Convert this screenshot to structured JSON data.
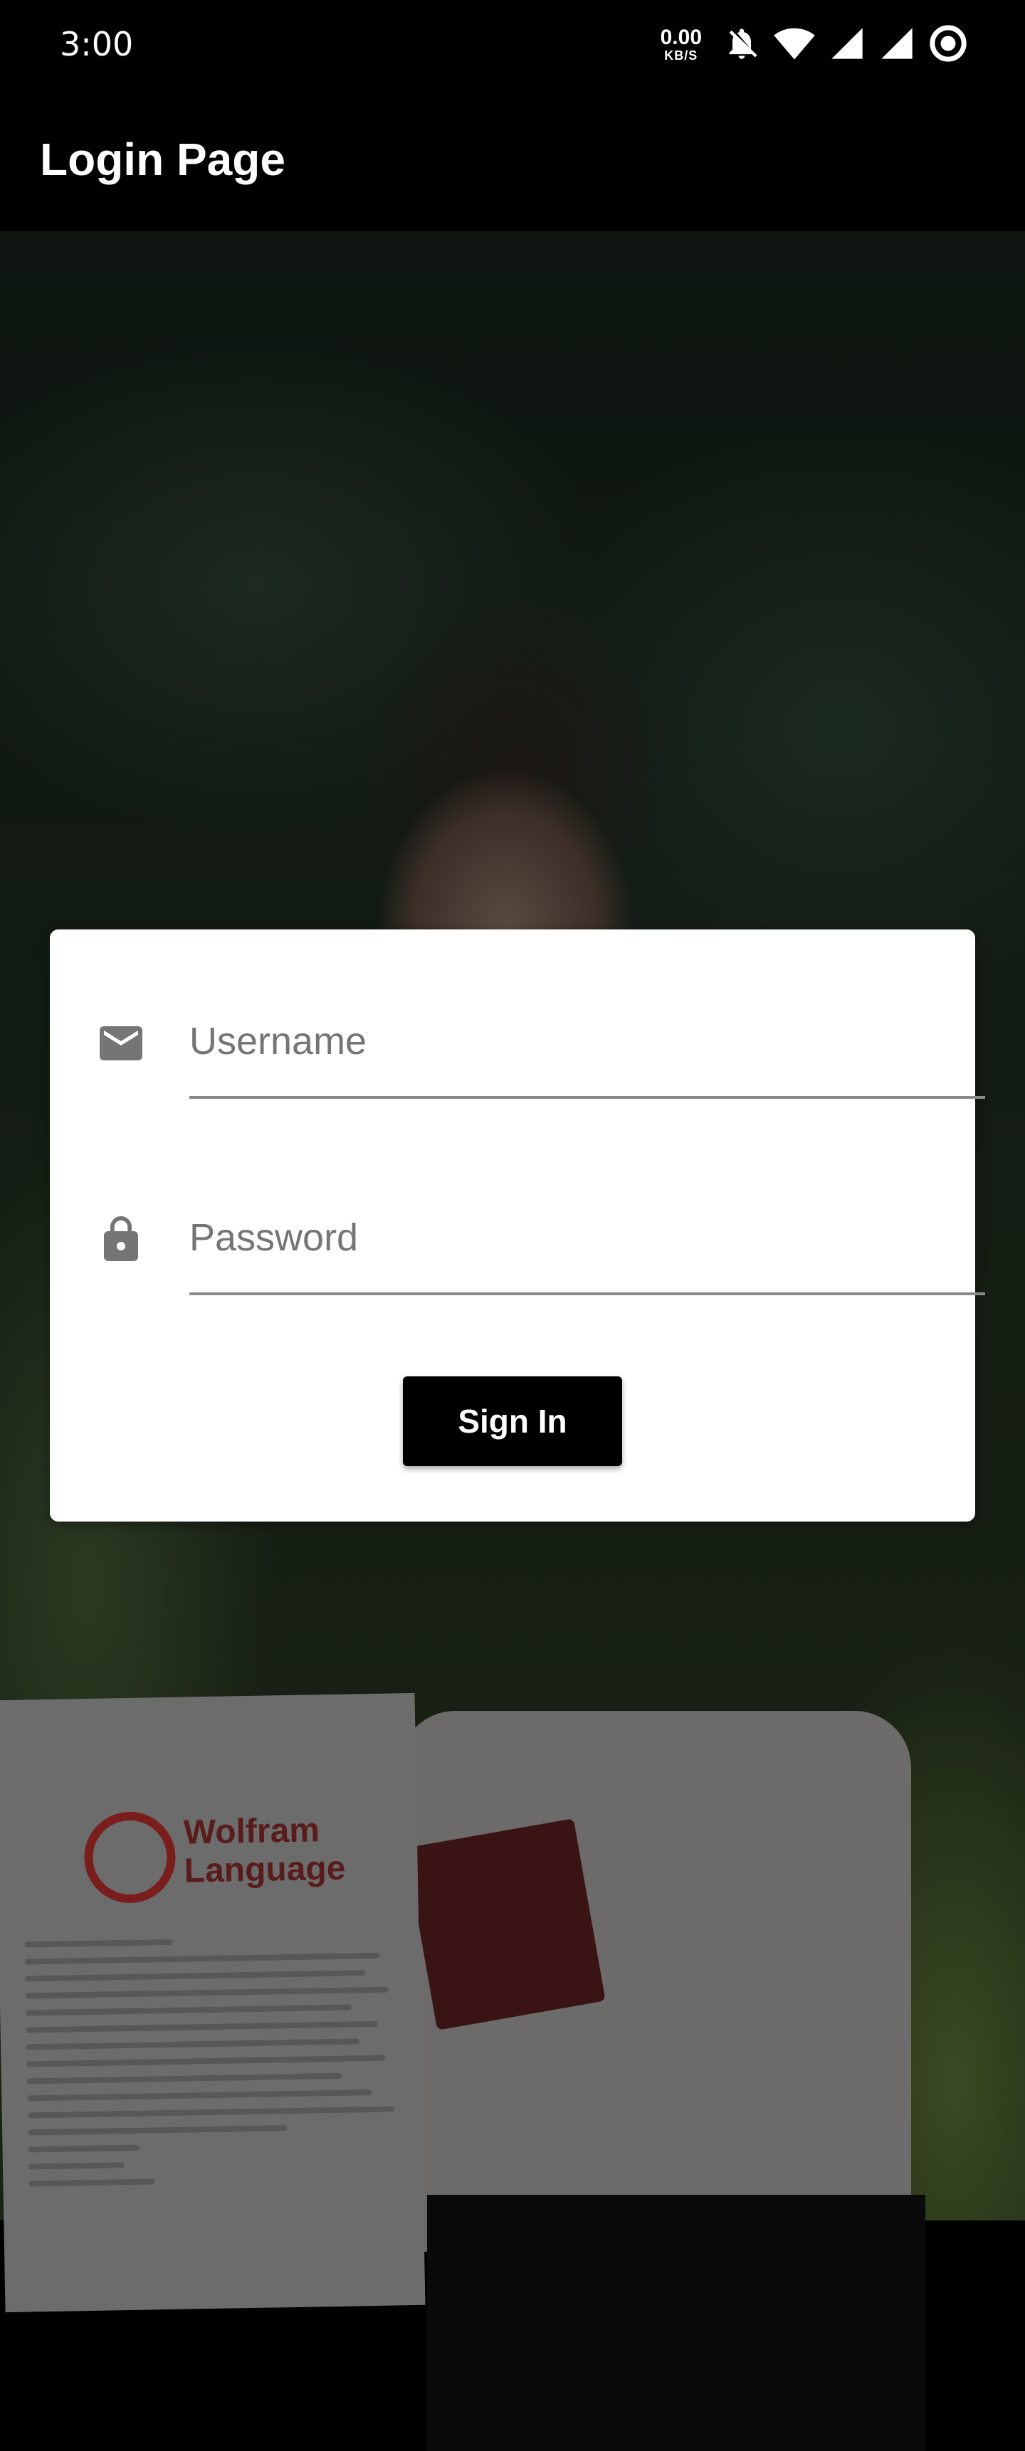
{
  "status_bar": {
    "time": "3:00",
    "net_speed_value": "0.00",
    "net_speed_unit": "KB/S",
    "icons": [
      "mute-bell-icon",
      "wifi-icon",
      "signal-icon",
      "signal-icon-2",
      "target-ring-icon"
    ]
  },
  "app_bar": {
    "title": "Login Page"
  },
  "login_form": {
    "username": {
      "placeholder": "Username",
      "value": "",
      "icon": "mail-icon"
    },
    "password": {
      "placeholder": "Password",
      "value": "",
      "icon": "lock-icon"
    },
    "submit_label": "Sign In"
  },
  "background_photo": {
    "paper_logo_text": "Wolfram Language"
  },
  "colors": {
    "app_bar": "#000000",
    "card": "#ffffff",
    "button": "#000000",
    "button_text": "#ffffff",
    "icon": "#757575"
  }
}
